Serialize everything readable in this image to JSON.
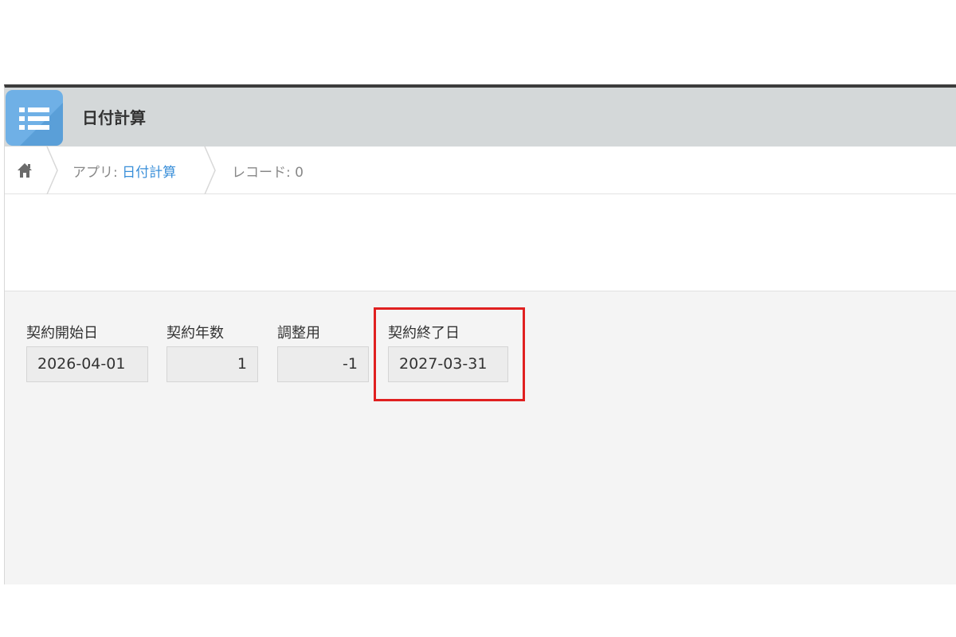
{
  "app": {
    "title": "日付計算",
    "icon": "list-icon"
  },
  "breadcrumb": {
    "home_icon": "home-icon",
    "app_prefix": "アプリ: ",
    "app_link": "日付計算",
    "record": "レコード: 0"
  },
  "fields": [
    {
      "label": "契約開始日",
      "value": "2026-04-01"
    },
    {
      "label": "契約年数",
      "value": "1"
    },
    {
      "label": "調整用",
      "value": "-1"
    },
    {
      "label": "契約終了日",
      "value": "2027-03-31"
    }
  ],
  "colors": {
    "header_bg": "#d4d8d9",
    "icon_bg": "#6fb0e6",
    "link": "#3a8fd9",
    "highlight": "#e02020",
    "form_bg": "#f4f4f4"
  }
}
